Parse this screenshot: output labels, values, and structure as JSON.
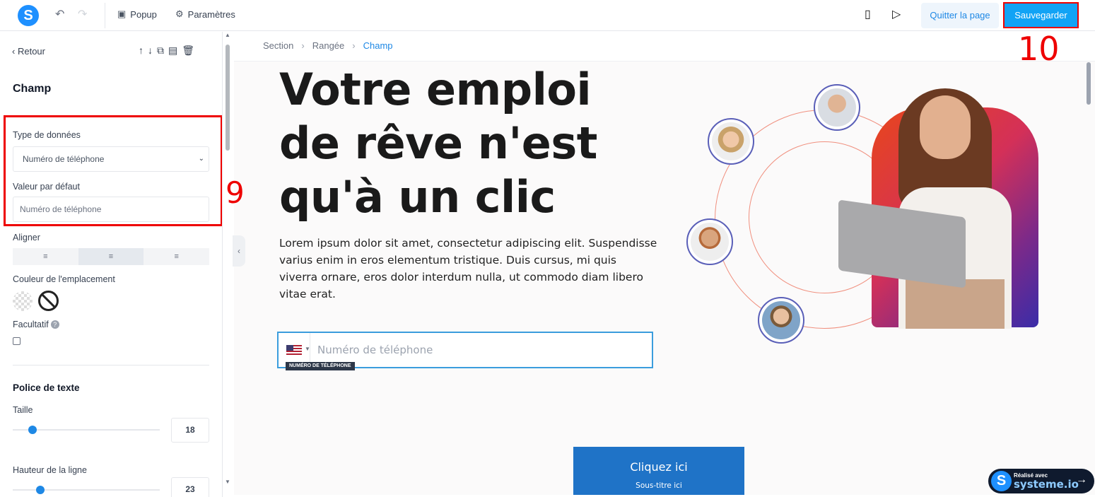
{
  "topbar": {
    "popup_label": "Popup",
    "settings_label": "Paramètres",
    "quit_label": "Quitter la page",
    "save_label": "Sauvegarder"
  },
  "panel": {
    "back_label": "Retour",
    "title": "Champ",
    "data_type_label": "Type de données",
    "data_type_value": "Numéro de téléphone",
    "default_value_label": "Valeur par défaut",
    "default_value_placeholder": "Numéro de téléphone",
    "align_label": "Aligner",
    "placeholder_color_label": "Couleur de l'emplacement",
    "optional_label": "Facultatif",
    "font_section_title": "Police de texte",
    "size_label": "Taille",
    "size_value": "18",
    "line_height_label": "Hauteur de la ligne",
    "line_height_value": "23"
  },
  "annotations": {
    "step_9": "9",
    "step_10": "10"
  },
  "breadcrumb": {
    "items": [
      "Section",
      "Rangée",
      "Champ"
    ]
  },
  "canvas": {
    "hero_title": "Votre emploi de rêve n'est qu'à un clic",
    "hero_text": "Lorem ipsum dolor sit amet, consectetur adipiscing elit. Suspendisse varius enim in eros elementum tristique. Duis cursus, mi quis viverra ornare, eros dolor interdum nulla, ut commodo diam libero vitae erat.",
    "phone_placeholder": "Numéro de téléphone",
    "field_tag": "NUMÉRO DE TÉLÉPHONE",
    "cta_label": "Cliquez ici",
    "cta_sub": "Sous-titre ici"
  },
  "badge": {
    "line1": "Réalisé avec",
    "line2": "systeme.io"
  },
  "colors": {
    "accent": "#12a3f5",
    "annotation": "#ee0000",
    "cta": "#1f73c7"
  }
}
